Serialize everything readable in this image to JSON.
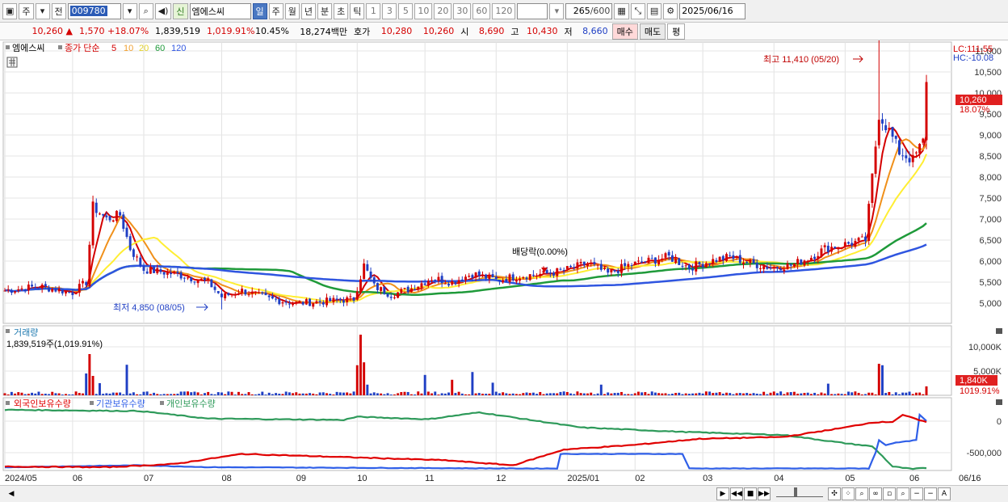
{
  "toolbar": {
    "market": "주",
    "prev": "전",
    "code": "009780",
    "stock_tag": "신",
    "stock_name": "엠에스씨",
    "periods": [
      "일",
      "주",
      "월",
      "년",
      "분",
      "초",
      "틱"
    ],
    "minutes": [
      "1",
      "3",
      "5",
      "10",
      "20",
      "30",
      "60",
      "120"
    ],
    "count": "265",
    "count_max": "/600",
    "date": "2025/06/16"
  },
  "quote": {
    "price": "10,260",
    "change": "1,570",
    "change_pct": "+18.07%",
    "volume": "1,839,519",
    "vol_ratio": "1,019.91%",
    "turnover_pct": "10.45%",
    "amount": "18,274백만",
    "hoga_label": "호가",
    "hoga1": "10,280",
    "hoga2": "10,260",
    "open_label": "시",
    "open": "8,690",
    "high_label": "고",
    "high": "10,430",
    "low_label": "저",
    "low": "8,660",
    "buy": "매수",
    "sell": "매도",
    "eval": "평"
  },
  "legend": {
    "name": "엠에스씨",
    "kind": "종가 단순",
    "ma": [
      "5",
      "10",
      "20",
      "60",
      "120"
    ],
    "lc": "LC:111.55",
    "hc": "HC:-10.08"
  },
  "annotations": {
    "high": "최고 11,410 (05/20)",
    "low": "최저 4,850 (08/05)",
    "dividend": "배당락(0.00%)"
  },
  "price_badge": {
    "value": "10,260",
    "pct": "18.07%"
  },
  "volume_panel": {
    "title": "거래량",
    "info": "1,839,519주(1,019.91%)",
    "badge": "1,840K",
    "pct": "1019.91%"
  },
  "holding_panel": {
    "items": [
      "외국인보유수량",
      "기관보유수량",
      "개인보유수량"
    ]
  },
  "colors": {
    "up": "#d40000",
    "down": "#1f3fc4",
    "ma5": "#d40000",
    "ma10": "#f0901a",
    "ma20": "#ffee33",
    "ma60": "#1f9a3a",
    "ma120": "#2f55e0",
    "foreign": "#e00000",
    "inst": "#2f5fe8",
    "indiv": "#2e9a5a"
  },
  "chart_data": {
    "type": "candlestick",
    "y_ticks": [
      "11,000",
      "10,500",
      "10,000",
      "9,500",
      "9,000",
      "8,500",
      "8,000",
      "7,500",
      "7,000",
      "6,500",
      "6,000",
      "5,500",
      "5,000"
    ],
    "ylim": [
      4600,
      11700
    ],
    "x_labels": [
      {
        "i": 0,
        "label": "2024/05"
      },
      {
        "i": 20,
        "label": "06"
      },
      {
        "i": 41,
        "label": "07"
      },
      {
        "i": 64,
        "label": "08"
      },
      {
        "i": 86,
        "label": "09"
      },
      {
        "i": 104,
        "label": "10"
      },
      {
        "i": 124,
        "label": "11"
      },
      {
        "i": 145,
        "label": "12"
      },
      {
        "i": 166,
        "label": "2025/01"
      },
      {
        "i": 186,
        "label": "02"
      },
      {
        "i": 206,
        "label": "03"
      },
      {
        "i": 227,
        "label": "04"
      },
      {
        "i": 248,
        "label": "05"
      },
      {
        "i": 267,
        "label": "06"
      }
    ],
    "x_last": "06/16",
    "close_anchors": [
      [
        0,
        5300
      ],
      [
        10,
        5400
      ],
      [
        20,
        5250
      ],
      [
        24,
        5500
      ],
      [
        26,
        7300
      ],
      [
        30,
        7000
      ],
      [
        34,
        7100
      ],
      [
        37,
        6300
      ],
      [
        41,
        5800
      ],
      [
        50,
        5700
      ],
      [
        60,
        5500
      ],
      [
        64,
        5150
      ],
      [
        70,
        5300
      ],
      [
        78,
        5100
      ],
      [
        86,
        5000
      ],
      [
        96,
        5050
      ],
      [
        103,
        5100
      ],
      [
        106,
        5900
      ],
      [
        109,
        5400
      ],
      [
        114,
        5200
      ],
      [
        120,
        5350
      ],
      [
        126,
        5600
      ],
      [
        132,
        5500
      ],
      [
        138,
        5700
      ],
      [
        145,
        5550
      ],
      [
        152,
        5650
      ],
      [
        160,
        5700
      ],
      [
        166,
        5800
      ],
      [
        172,
        5950
      ],
      [
        178,
        5700
      ],
      [
        184,
        5900
      ],
      [
        190,
        6000
      ],
      [
        196,
        6100
      ],
      [
        202,
        5850
      ],
      [
        208,
        6000
      ],
      [
        214,
        6100
      ],
      [
        220,
        5950
      ],
      [
        226,
        5850
      ],
      [
        232,
        5900
      ],
      [
        238,
        6100
      ],
      [
        242,
        6300
      ],
      [
        248,
        6400
      ],
      [
        254,
        6500
      ],
      [
        258,
        9500
      ],
      [
        261,
        9100
      ],
      [
        264,
        8600
      ],
      [
        268,
        8400
      ],
      [
        271,
        8850
      ],
      [
        272,
        10260
      ]
    ],
    "volume_k": [
      [
        24,
        4500
      ],
      [
        25,
        8500
      ],
      [
        26,
        4000
      ],
      [
        28,
        2500
      ],
      [
        36,
        6300
      ],
      [
        104,
        6200
      ],
      [
        105,
        12500
      ],
      [
        106,
        6800
      ],
      [
        107,
        2200
      ],
      [
        124,
        4200
      ],
      [
        132,
        3200
      ],
      [
        138,
        4800
      ],
      [
        144,
        2600
      ],
      [
        176,
        2200
      ],
      [
        243,
        2400
      ],
      [
        258,
        6500
      ],
      [
        259,
        6200
      ],
      [
        272,
        1840
      ]
    ],
    "volume_ticks": [
      "10,000K",
      "5,000K"
    ],
    "holding_ticks": [
      "0",
      "-500,000"
    ],
    "series": [
      {
        "name": "외국인보유수량"
      },
      {
        "name": "기관보유수량"
      },
      {
        "name": "개인보유수량"
      }
    ]
  }
}
